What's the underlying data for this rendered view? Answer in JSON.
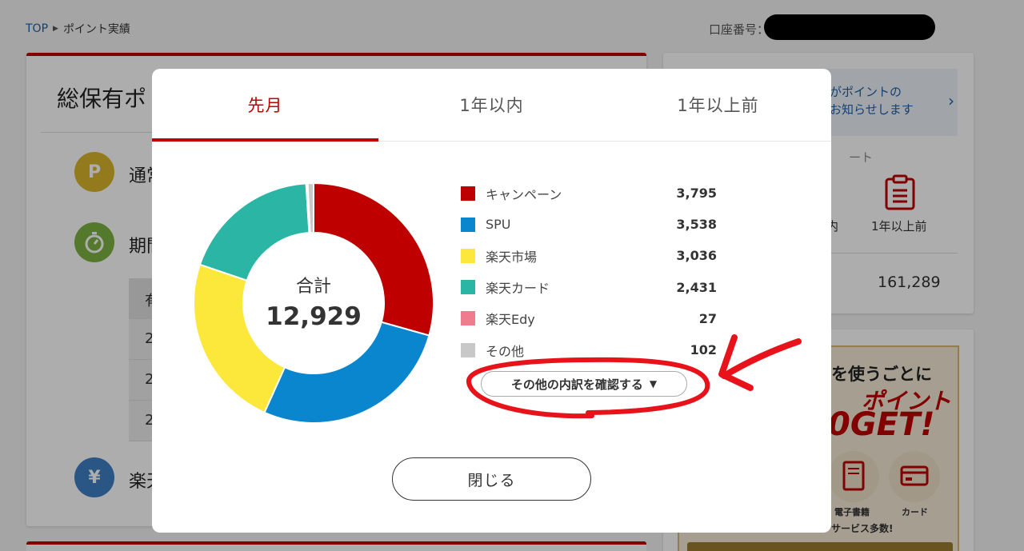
{
  "breadcrumb": {
    "home": "TOP",
    "current": "ポイント実績"
  },
  "account": {
    "label": "口座番号："
  },
  "background": {
    "main_title": "総保有ポ",
    "rows": [
      {
        "icon_text": "P",
        "text": "通常",
        "color": "#d9b62c"
      },
      {
        "icon_text": "",
        "text": "期間",
        "color": "#7cb342"
      },
      {
        "icon_text": "¥",
        "text": "楽天",
        "color": "#3f7fc4"
      }
    ],
    "table_rows": [
      "有",
      "2",
      "2",
      "2"
    ],
    "side": {
      "notice": "がポイントの\nお知らせします",
      "sub": "ート",
      "label_a": "内",
      "label_b": "1年以上前",
      "total": "161,289"
    },
    "promo": {
      "line1": "を使うごとに",
      "big1": "ポイント",
      "big2": "0GET!",
      "icon1_label": "電子書籍",
      "icon2_label": "カード",
      "foot": "サービス多数!"
    }
  },
  "modal": {
    "tabs": [
      {
        "label": "先月",
        "active": true
      },
      {
        "label": "1年以内",
        "active": false
      },
      {
        "label": "1年以上前",
        "active": false
      }
    ],
    "donut_title": "合計",
    "donut_total": "12,929",
    "detail_button": "その他の内訳を確認する",
    "close_button": "閉じる"
  },
  "chart_data": {
    "type": "pie",
    "title": "合計",
    "total": 12929,
    "categories": [
      "キャンペーン",
      "SPU",
      "楽天市場",
      "楽天カード",
      "楽天Edy",
      "その他"
    ],
    "values": [
      3795,
      3538,
      3036,
      2431,
      27,
      102
    ],
    "display_values": [
      "3,795",
      "3,538",
      "3,036",
      "2,431",
      "27",
      "102"
    ],
    "colors": [
      "#bf0000",
      "#0a86cf",
      "#fce83a",
      "#2bb5a4",
      "#f07b8f",
      "#c8c8c8"
    ]
  },
  "annotation": {
    "color": "#e8121b"
  }
}
